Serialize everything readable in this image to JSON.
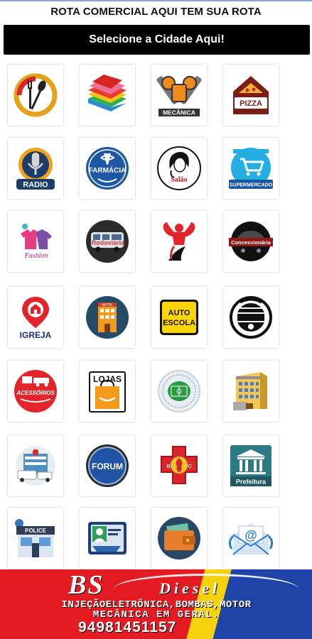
{
  "header": {
    "title": "ROTA COMERCIAL AQUI TEM SUA ROTA",
    "city_button_label": "Selecione a Cidade Aqui!"
  },
  "categories": [
    {
      "icon": "restaurant-icon",
      "label": ""
    },
    {
      "icon": "books-icon",
      "label": ""
    },
    {
      "icon": "mechanic-icon",
      "label": "MECÂNICA"
    },
    {
      "icon": "pizza-icon",
      "label": "PIZZA"
    },
    {
      "icon": "radio-icon",
      "label": "RADIO"
    },
    {
      "icon": "pharmacy-icon",
      "label": "FARMÁCIA"
    },
    {
      "icon": "salon-icon",
      "label": "Salão"
    },
    {
      "icon": "supermarket-icon",
      "label": "SUPERMERCADO"
    },
    {
      "icon": "fashion-icon",
      "label": "Fashion"
    },
    {
      "icon": "bus-station-icon",
      "label": "Rodoviária"
    },
    {
      "icon": "gym-icon",
      "label": ""
    },
    {
      "icon": "car-dealership-icon",
      "label": "Concessionária"
    },
    {
      "icon": "church-icon",
      "label": "IGREJA"
    },
    {
      "icon": "hotel-icon",
      "label": "HOTEL"
    },
    {
      "icon": "driving-school-icon",
      "label": "AUTO ESCOLA"
    },
    {
      "icon": "auto-parts-icon",
      "label": ""
    },
    {
      "icon": "accessories-icon",
      "label": "ACESSÓRIOS"
    },
    {
      "icon": "shops-icon",
      "label": "LOJAS"
    },
    {
      "icon": "stadium-icon",
      "label": ""
    },
    {
      "icon": "building-icon",
      "label": ""
    },
    {
      "icon": "hospital-icon",
      "label": ""
    },
    {
      "icon": "forum-icon",
      "label": "FORUM"
    },
    {
      "icon": "fire-department-icon",
      "label": ""
    },
    {
      "icon": "city-hall-icon",
      "label": "Prefeitura"
    },
    {
      "icon": "police-icon",
      "label": "POLICE"
    },
    {
      "icon": "id-card-icon",
      "label": ""
    },
    {
      "icon": "wallet-icon",
      "label": ""
    },
    {
      "icon": "email-icon",
      "label": "@"
    }
  ],
  "banner": {
    "brand": "BS",
    "brand_sub": "Diesel",
    "line1": "INJEÇÃOELETRÔNICA,BOMBAS,MOTOR",
    "line2": "MECÂNICA EM GERAL.",
    "phone": "94981451157"
  },
  "colors": {
    "header_button_bg": "#000000",
    "banner_red": "#e51b24",
    "banner_yellow": "#f6d10e",
    "banner_blue": "#2043a8"
  }
}
